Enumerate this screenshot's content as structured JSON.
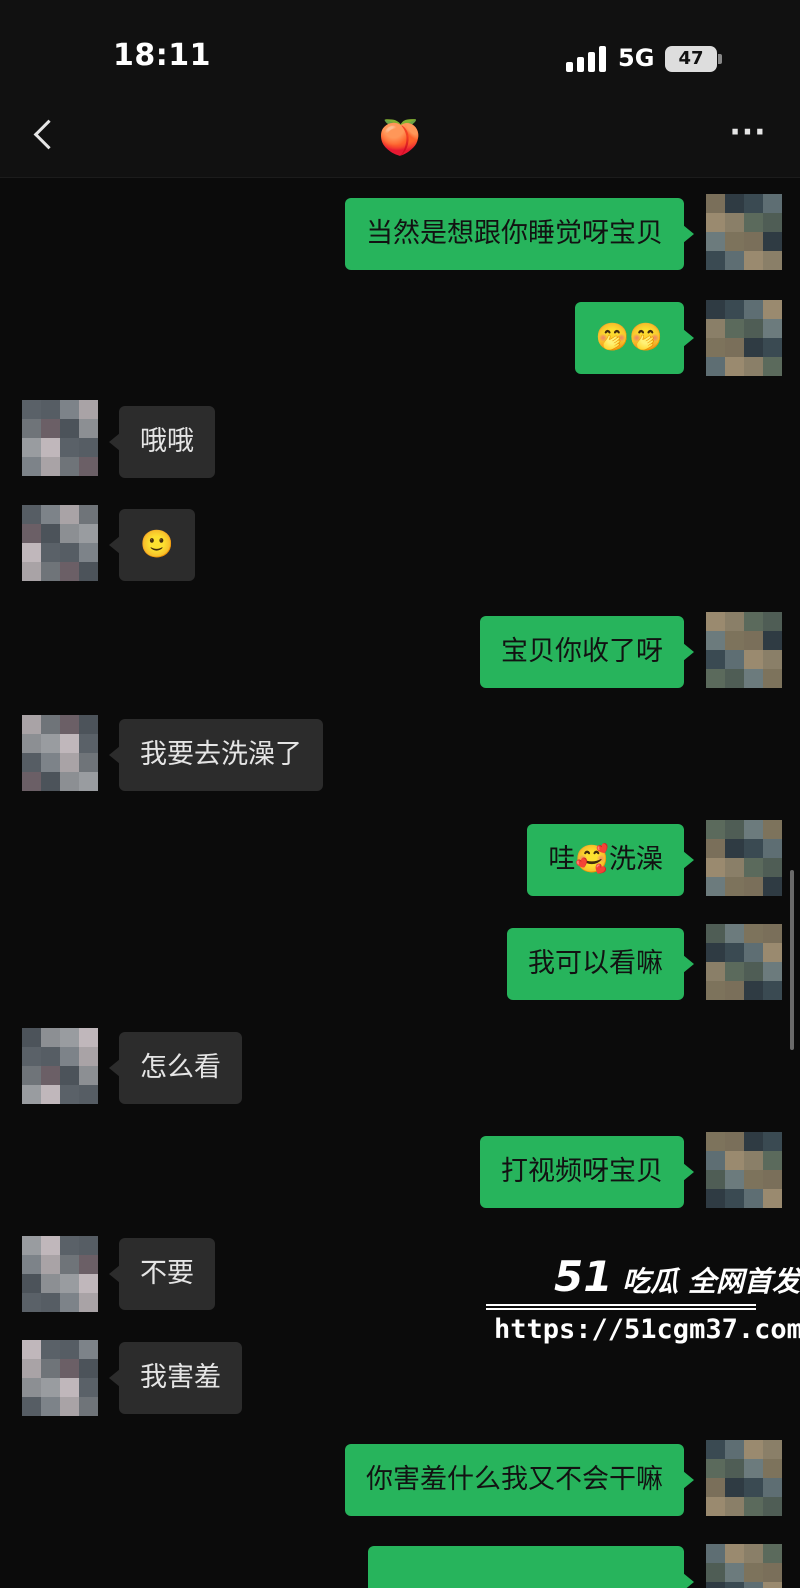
{
  "status_bar": {
    "time": "18:11",
    "network": "5G",
    "battery": "47"
  },
  "nav": {
    "title": "🍑",
    "back_icon": "chevron-left-icon",
    "more_label": "···"
  },
  "messages": [
    {
      "from": "me",
      "text": "当然是想跟你睡觉呀宝贝"
    },
    {
      "from": "me",
      "text": "🤭🤭"
    },
    {
      "from": "them",
      "text": "哦哦"
    },
    {
      "from": "them",
      "text": "🙂"
    },
    {
      "from": "me",
      "text": "宝贝你收了呀"
    },
    {
      "from": "them",
      "text": "我要去洗澡了"
    },
    {
      "from": "me",
      "text": "哇🥰洗澡"
    },
    {
      "from": "me",
      "text": "我可以看嘛"
    },
    {
      "from": "them",
      "text": "怎么看"
    },
    {
      "from": "me",
      "text": "打视频呀宝贝"
    },
    {
      "from": "them",
      "text": "不要"
    },
    {
      "from": "them",
      "text": "我害羞"
    },
    {
      "from": "me",
      "text": "你害羞什么我又不会干嘛"
    }
  ],
  "watermark": {
    "brand_number": "51",
    "brand_text": "吃瓜 全网首发",
    "url": "https://51cgm37.com"
  },
  "colors": {
    "me_bubble": "#27b45c",
    "them_bubble": "#2c2c2c",
    "background": "#0b0b0b"
  }
}
